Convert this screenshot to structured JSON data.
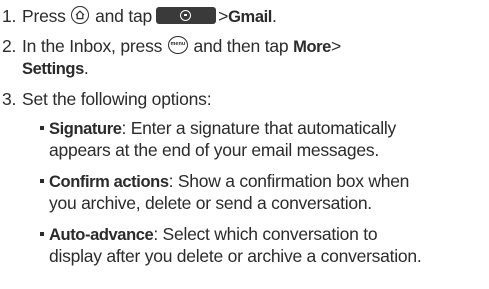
{
  "steps": [
    {
      "num": "1.",
      "text_press": "Press",
      "text_and_tap": "and tap",
      "gt": ">",
      "gmail": "Gmail",
      "period": "."
    },
    {
      "num": "2.",
      "text_a": "In the Inbox, press",
      "text_b": "and then tap",
      "more": "More",
      "gt": ">",
      "settings": "Settings",
      "period": "."
    },
    {
      "num": "3.",
      "text": "Set the following options:"
    }
  ],
  "options": [
    {
      "label": "Signature",
      "line1": ": Enter a signature that automatically",
      "line2": "appears at the end of your email messages."
    },
    {
      "label": "Confirm actions",
      "line1": ": Show a confirmation box when",
      "line2": "you archive, delete or send a conversation."
    },
    {
      "label": "Auto-advance",
      "line1": ": Select which conversation to",
      "line2": "display after you delete or archive a conversation."
    }
  ],
  "icons": {
    "home": "home-icon",
    "menu": "menu-icon",
    "menu_text": "menu",
    "apps": "all-apps-icon"
  }
}
